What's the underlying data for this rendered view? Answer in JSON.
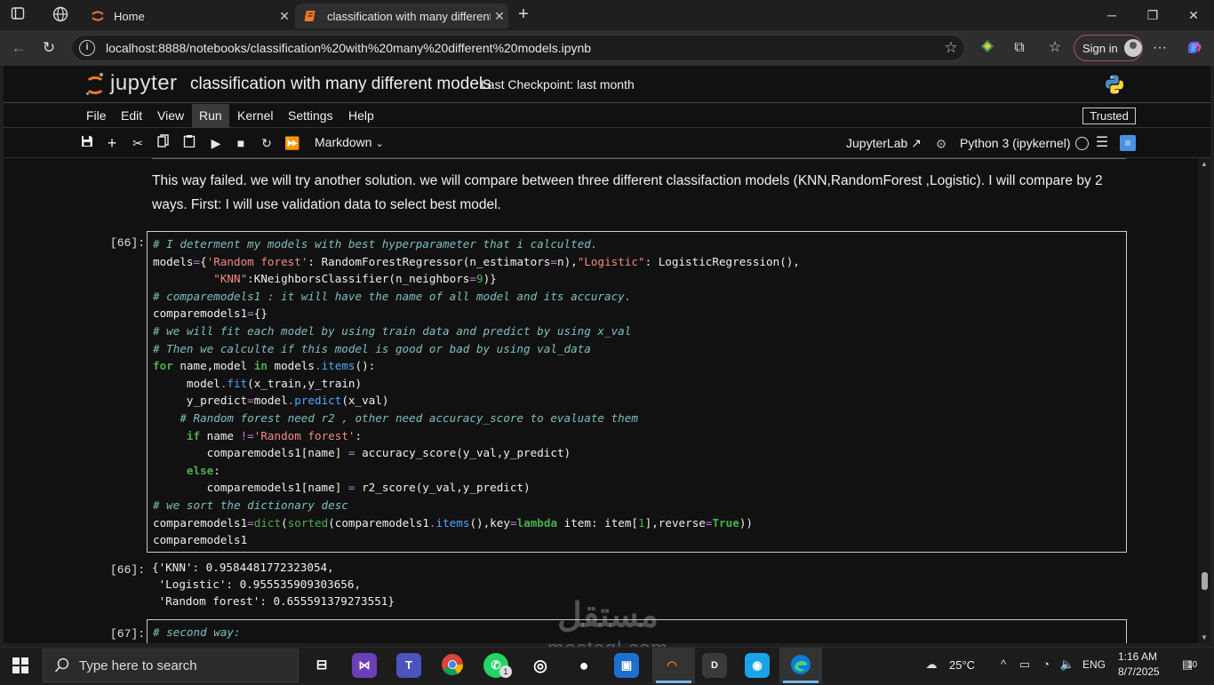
{
  "browser": {
    "tabs": [
      {
        "label": "Home",
        "active": false
      },
      {
        "label": "classification with many different models",
        "active": true
      }
    ],
    "url": "localhost:8888/notebooks/classification%20with%20many%20different%20models.ipynb",
    "sign_in_label": "Sign in"
  },
  "jupyter": {
    "logo_text": "jupyter",
    "notebook_title": "classification with many different models",
    "checkpoint": "Last Checkpoint: last month",
    "menu": [
      "File",
      "Edit",
      "View",
      "Run",
      "Kernel",
      "Settings",
      "Help"
    ],
    "active_menu": "Run",
    "trusted_label": "Trusted",
    "cell_type": "Markdown",
    "jupyterlab_label": "JupyterLab",
    "kernel_label": "Python 3 (ipykernel)"
  },
  "notebook": {
    "markdown_text": "This way failed. we will try another solution. we will compare between three different classifaction models (KNN,RandomForest ,Logistic). I will compare by 2 ways. First: I will use validation data to select best model.",
    "cell66_prompt": "[66]:",
    "cell66_code": [
      "# I determent my models with best hyperparameter that i calculted.",
      "models={'Random forest': RandomForestRegressor(n_estimators=n),\"Logistic\": LogisticRegression(),",
      "         \"KNN\":KNeighborsClassifier(n_neighbors=9)}",
      "# comparemodels1 : it will have the name of all model and its accuracy.",
      "comparemodels1={}",
      "# we will fit each model by using train data and predict by using x_val",
      "# Then we calculte if this model is good or bad by using val_data",
      "for name,model in models.items():",
      "     model.fit(x_train,y_train)",
      "     y_predict=model.predict(x_val)",
      "    # Random forest need r2 , other need accuracy_score to evaluate them",
      "     if name !='Random forest':",
      "        comparemodels1[name] = accuracy_score(y_val,y_predict)",
      "     else:",
      "        comparemodels1[name] = r2_score(y_val,y_predict)",
      "# we sort the dictionary desc",
      "comparemodels1=dict(sorted(comparemodels1.items(),key=lambda item: item[1],reverse=True))",
      "comparemodels1"
    ],
    "out66_prompt": "[66]:",
    "out66_lines": [
      "{'KNN': 0.9584481772323054,",
      " 'Logistic': 0.955535909303656,",
      " 'Random forest': 0.655591379273551}"
    ],
    "cell67_prompt": "[67]:",
    "cell67_code": [
      "# second way:"
    ]
  },
  "watermark": {
    "arabic": "مستقل",
    "latin": "mostaql.com"
  },
  "taskbar": {
    "search_placeholder": "Type here to search",
    "weather": "25°C",
    "language": "ENG",
    "time": "1:16 AM",
    "date": "8/7/2025",
    "notification_count": "10",
    "whatsapp_badge": "1"
  }
}
